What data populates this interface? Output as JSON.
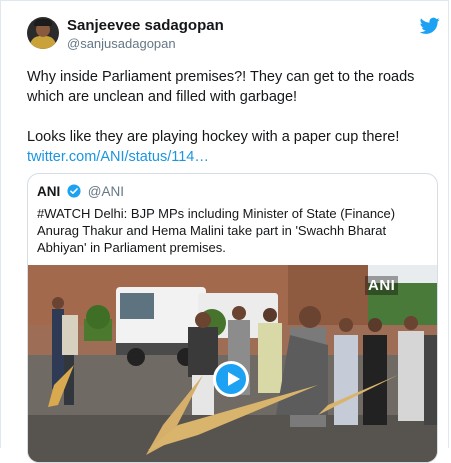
{
  "tweet": {
    "author_name": "Sanjeevee sadagopan",
    "author_handle": "@sanjusadagopan",
    "paragraph1": "Why inside Parliament premises?! They can get to the roads which are unclean and filled with garbage!",
    "paragraph2": "Looks like they are playing hockey with a paper cup there!",
    "link_text": "twitter.com/ANI/status/114…"
  },
  "quoted": {
    "author_name": "ANI",
    "author_handle": "@ANI",
    "text": "#WATCH Delhi: BJP MPs including Minister of State (Finance) Anurag Thakur and Hema Malini take part in 'Swachh Bharat Abhiyan' in Parliament premises.",
    "watermark": "ANI"
  },
  "icons": {
    "brand": "twitter-bird-icon",
    "verified": "verified-badge-icon",
    "play": "play-icon"
  },
  "colors": {
    "link": "#1b95e0",
    "twitter_blue": "#1da1f2",
    "handle_gray": "#657786"
  }
}
